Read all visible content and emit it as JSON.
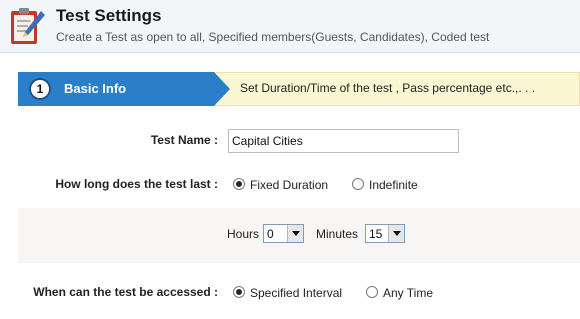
{
  "header": {
    "title": "Test Settings",
    "subtitle": "Create a Test as open to all, Specified members(Guests, Candidates), Coded test",
    "icon": "clipboard-pencil-icon"
  },
  "step": {
    "number": "1",
    "label": "Basic Info",
    "description": "Set Duration/Time of the test , Pass percentage etc.,. . .",
    "colors": {
      "active": "#2b7fc8",
      "banner": "#fbf7d2"
    }
  },
  "form": {
    "test_name_label": "Test Name :",
    "test_name_value": "Capital Cities",
    "duration_label": "How long does the test last :",
    "duration_options": [
      {
        "label": "Fixed Duration",
        "checked": true
      },
      {
        "label": "Indefinite",
        "checked": false
      }
    ],
    "hours_label": "Hours",
    "hours_value": "0",
    "minutes_label": "Minutes",
    "minutes_value": "15",
    "access_label": "When can the test be accessed :",
    "access_options": [
      {
        "label": "Specified Interval",
        "checked": true
      },
      {
        "label": "Any Time",
        "checked": false
      }
    ]
  }
}
